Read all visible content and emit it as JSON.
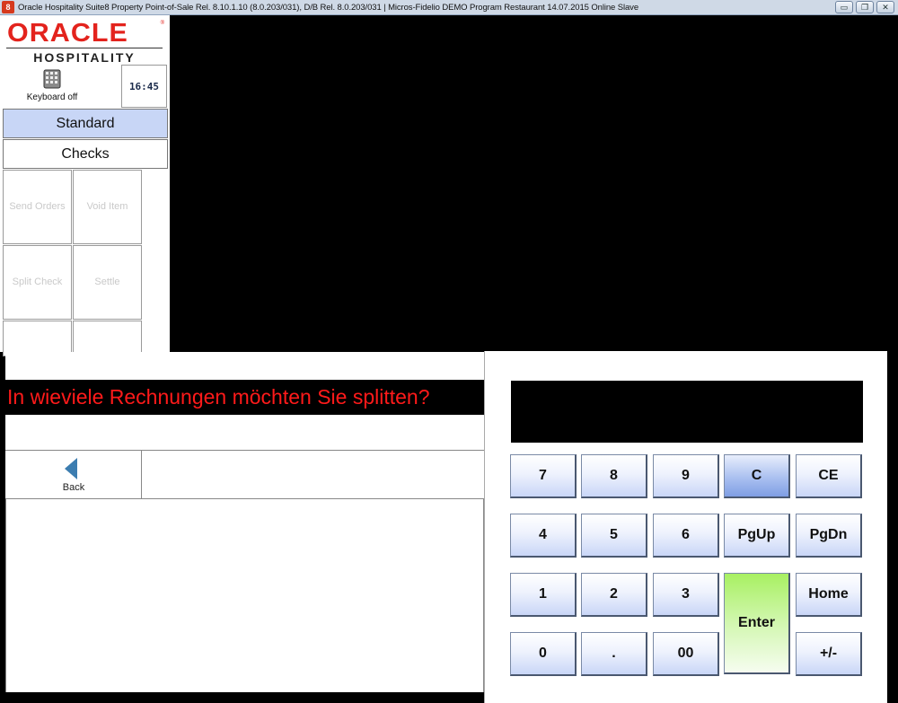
{
  "window": {
    "title": "Oracle Hospitality Suite8 Property Point-of-Sale Rel. 8.10.1.10 (8.0.203/031), D/B Rel. 8.0.203/031 | Micros-Fidelio DEMO Program Restaurant 14.07.2015 Online Slave",
    "app_icon": "8",
    "minimize_glyph": "▭",
    "restore_glyph": "❐",
    "close_glyph": "✕"
  },
  "logo": {
    "brand": "ORACLE",
    "registered": "®",
    "sub": "HOSPITALITY"
  },
  "keyboard": {
    "label": "Keyboard off",
    "icon": "keyboard-icon"
  },
  "clock": {
    "time": "16:45"
  },
  "tabs": {
    "standard": "Standard",
    "checks": "Checks"
  },
  "function_buttons": [
    {
      "label": "Send Orders"
    },
    {
      "label": "Void Item"
    },
    {
      "label": "Split Check"
    },
    {
      "label": "Settle"
    },
    {
      "label": ""
    },
    {
      "label": ""
    }
  ],
  "prompt": {
    "text": "In wieviele Rechnungen möchten Sie splitten?"
  },
  "back": {
    "label": "Back",
    "icon": "back-arrow-icon"
  },
  "display": {
    "value": ""
  },
  "keys": {
    "k7": "7",
    "k8": "8",
    "k9": "9",
    "c": "C",
    "ce": "CE",
    "k4": "4",
    "k5": "5",
    "k6": "6",
    "pgup": "PgUp",
    "pgdn": "PgDn",
    "k1": "1",
    "k2": "2",
    "k3": "3",
    "enter": "Enter",
    "home": "Home",
    "k0": "0",
    "dot": ".",
    "k00": "00",
    "plusminus": "+/-"
  },
  "colors": {
    "prompt_text": "#ff1a1a",
    "tab_active": "#c8d6f6",
    "enter_key": "#a8f062",
    "clear_key": "#7f9ee4",
    "brand_red": "#e3231d"
  }
}
